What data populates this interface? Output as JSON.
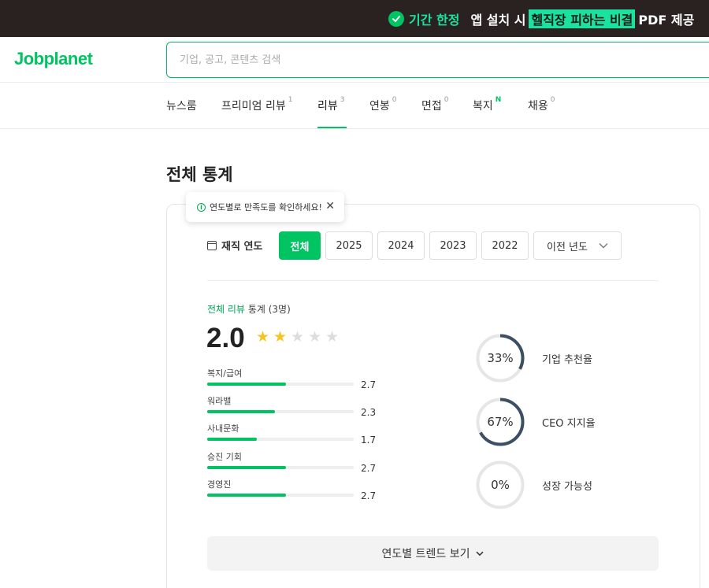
{
  "promo": {
    "time_label": "기간 한정",
    "text_before": "앱 설치 시",
    "highlight": "헬직장 피하는 비결",
    "text_after": "PDF 제공"
  },
  "header": {
    "logo": "Jobplanet",
    "search_placeholder": "기업, 공고, 콘텐츠 검색"
  },
  "tabs": [
    {
      "label": "뉴스룸",
      "count": ""
    },
    {
      "label": "프리미엄 리뷰",
      "count": "1"
    },
    {
      "label": "리뷰",
      "count": "3",
      "active": true
    },
    {
      "label": "연봉",
      "count": "0"
    },
    {
      "label": "면접",
      "count": "0"
    },
    {
      "label": "복지",
      "count": "N"
    },
    {
      "label": "채용",
      "count": "0"
    }
  ],
  "section": {
    "title": "전체 통계"
  },
  "tooltip": {
    "text": "연도별로 만족도를 확인하세요!"
  },
  "year_filter": {
    "label": "재직 연도",
    "options": [
      "전체",
      "2025",
      "2024",
      "2023",
      "2022"
    ],
    "active": "전체",
    "dropdown_label": "이전 년도"
  },
  "stats": {
    "header_highlight": "전체 리뷰",
    "header_rest": "통계 (3명)",
    "score": "2.0",
    "stars_filled": 2,
    "stars_total": 5,
    "categories": [
      {
        "name": "복지/급여",
        "value": "2.7",
        "ratio": 0.54
      },
      {
        "name": "워라밸",
        "value": "2.3",
        "ratio": 0.46
      },
      {
        "name": "사내문화",
        "value": "1.7",
        "ratio": 0.34
      },
      {
        "name": "승진 기회",
        "value": "2.7",
        "ratio": 0.54
      },
      {
        "name": "경영진",
        "value": "2.7",
        "ratio": 0.54
      }
    ],
    "rings": [
      {
        "percent": "33%",
        "ratio": 0.33,
        "name": "기업 추천율"
      },
      {
        "percent": "67%",
        "ratio": 0.67,
        "name": "CEO 지지율"
      },
      {
        "percent": "0%",
        "ratio": 0.0,
        "name": "성장 가능성"
      }
    ]
  },
  "trend_button": {
    "label": "연도별 트렌드 보기"
  },
  "colors": {
    "brand_green": "#00c362",
    "promo_bg": "#2a2220",
    "promo_accent": "#19e39e",
    "star": "#f4c521",
    "ring_fill": "#3d4f63",
    "ring_track": "#e6e6e6"
  }
}
